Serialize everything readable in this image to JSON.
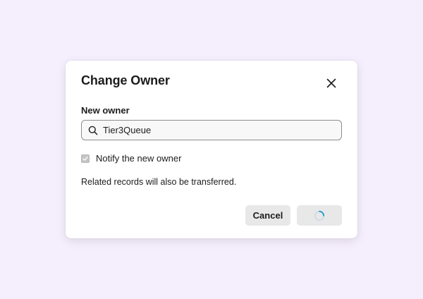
{
  "dialog": {
    "title": "Change Owner",
    "close_icon": "close-icon"
  },
  "owner_field": {
    "label": "New owner",
    "value": "Tier3Queue",
    "icon": "search-icon"
  },
  "notify": {
    "label": "Notify the new owner",
    "checked": true,
    "disabled": true
  },
  "note": "Related records will also be transferred.",
  "actions": {
    "cancel_label": "Cancel",
    "submit_state": "loading",
    "spinner_icon": "spinner-icon"
  },
  "colors": {
    "background": "#f5eefd",
    "spinner_accent": "#1d9bd1",
    "button_bg": "#e8e8e8"
  }
}
